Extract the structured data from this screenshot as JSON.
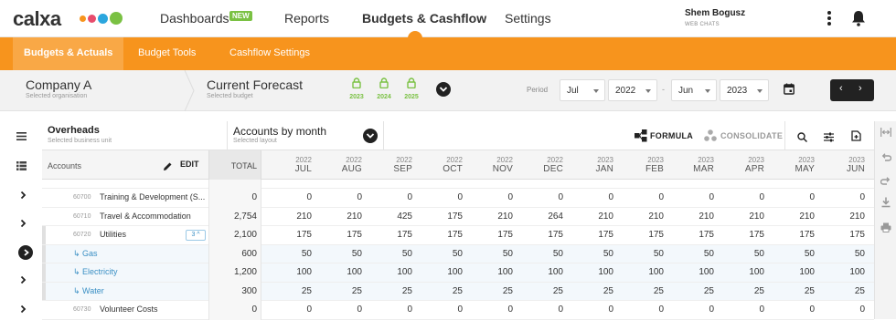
{
  "brand": {
    "logo": "calxa",
    "dot_colors": [
      "#f7941d",
      "#e84c6c",
      "#2ba6de",
      "#7ac143"
    ]
  },
  "nav": {
    "dashboards": "Dashboards",
    "new_badge": "NEW",
    "reports": "Reports",
    "budgets": "Budgets & Cashflow",
    "settings": "Settings",
    "user_name": "Shem Bogusz",
    "user_role": "WEB CHATS"
  },
  "subnav": {
    "tabs": [
      "Budgets & Actuals",
      "Budget Tools",
      "Cashflow Settings"
    ],
    "active_index": 0
  },
  "context": {
    "org": "Company A",
    "org_sub": "Selected organisation",
    "budget": "Current Forecast",
    "budget_sub": "Selected budget",
    "locks": [
      "2023",
      "2024",
      "2025"
    ],
    "period_label": "Period",
    "from_month": "Jul",
    "from_year": "2022",
    "dash": "-",
    "to_month": "Jun",
    "to_year": "2023"
  },
  "toolbar": {
    "business_unit": "Overheads",
    "business_unit_sub": "Selected business unit",
    "layout": "Accounts by month",
    "layout_sub": "Selected layout",
    "formula": "FORMULA",
    "consolidate": "CONSOLIDATE"
  },
  "grid": {
    "accounts_label": "Accounts",
    "edit_label": "EDIT",
    "total_label": "TOTAL",
    "columns": [
      {
        "year": "2022",
        "month": "JUL"
      },
      {
        "year": "2022",
        "month": "AUG"
      },
      {
        "year": "2022",
        "month": "SEP"
      },
      {
        "year": "2022",
        "month": "OCT"
      },
      {
        "year": "2022",
        "month": "NOV"
      },
      {
        "year": "2022",
        "month": "DEC"
      },
      {
        "year": "2023",
        "month": "JAN"
      },
      {
        "year": "2023",
        "month": "FEB"
      },
      {
        "year": "2023",
        "month": "MAR"
      },
      {
        "year": "2023",
        "month": "APR"
      },
      {
        "year": "2023",
        "month": "MAY"
      },
      {
        "year": "2023",
        "month": "JUN"
      }
    ],
    "rows": [
      {
        "code": "60700",
        "name": "Training & Development (S...",
        "sub": false,
        "total": "0",
        "values": [
          "0",
          "0",
          "0",
          "0",
          "0",
          "0",
          "0",
          "0",
          "0",
          "0",
          "0",
          "0"
        ]
      },
      {
        "code": "60710",
        "name": "Travel & Accommodation",
        "sub": false,
        "total": "2,754",
        "values": [
          "210",
          "210",
          "425",
          "175",
          "210",
          "264",
          "210",
          "210",
          "210",
          "210",
          "210",
          "210"
        ]
      },
      {
        "code": "60720",
        "name": "Utilities",
        "sub": false,
        "badge": "3 ^",
        "total": "2,100",
        "values": [
          "175",
          "175",
          "175",
          "175",
          "175",
          "175",
          "175",
          "175",
          "175",
          "175",
          "175",
          "175"
        ]
      },
      {
        "code": "",
        "name": "↳ Gas",
        "sub": true,
        "total": "600",
        "values": [
          "50",
          "50",
          "50",
          "50",
          "50",
          "50",
          "50",
          "50",
          "50",
          "50",
          "50",
          "50"
        ]
      },
      {
        "code": "",
        "name": "↳ Electricity",
        "sub": true,
        "total": "1,200",
        "values": [
          "100",
          "100",
          "100",
          "100",
          "100",
          "100",
          "100",
          "100",
          "100",
          "100",
          "100",
          "100"
        ]
      },
      {
        "code": "",
        "name": "↳ Water",
        "sub": true,
        "total": "300",
        "values": [
          "25",
          "25",
          "25",
          "25",
          "25",
          "25",
          "25",
          "25",
          "25",
          "25",
          "25",
          "25"
        ]
      },
      {
        "code": "60730",
        "name": "Volunteer Costs",
        "sub": false,
        "total": "0",
        "values": [
          "0",
          "0",
          "0",
          "0",
          "0",
          "0",
          "0",
          "0",
          "0",
          "0",
          "0",
          "0"
        ]
      }
    ]
  },
  "colors": {
    "orange": "#f7941d",
    "green": "#7ac143",
    "blue": "#3a8fc4"
  }
}
